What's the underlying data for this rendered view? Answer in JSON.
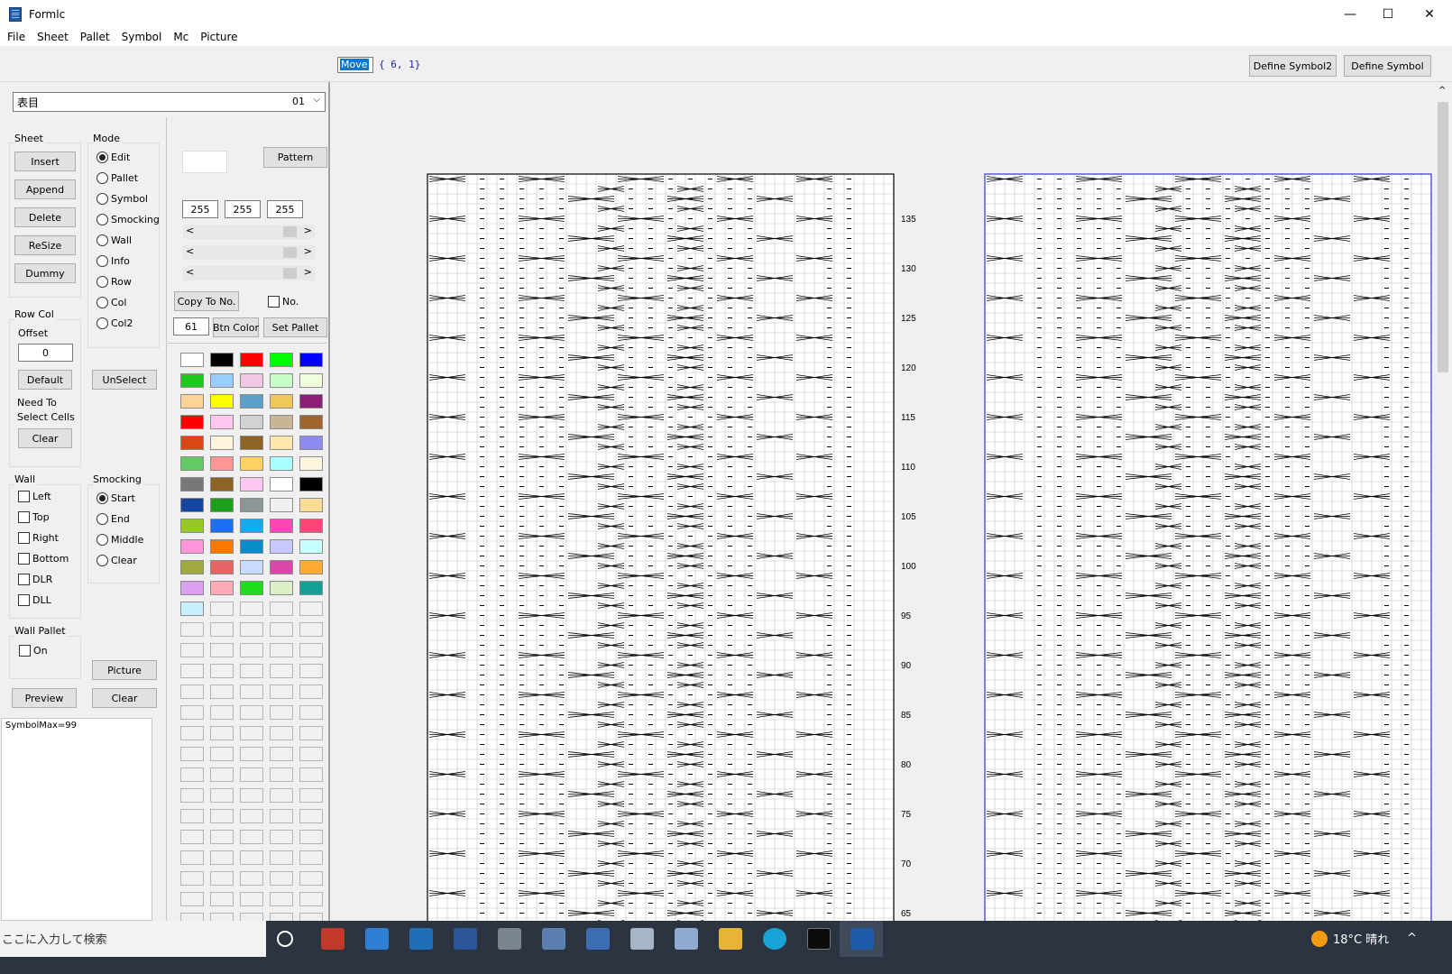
{
  "window": {
    "title": "Formlc",
    "minimize_glyph": "—",
    "maximize_glyph": "☐",
    "close_glyph": "✕",
    "icon": "app-grid-icon"
  },
  "menu": [
    "File",
    "Sheet",
    "Pallet",
    "Symbol",
    "Mc",
    "Picture"
  ],
  "toolbar": {
    "mode_value": "Move",
    "coords": "{ 6, 1}",
    "define_symbol2": "Define Symbol2",
    "define_symbol": "Define Symbol"
  },
  "sheet_select": {
    "value": "表目",
    "number": "01",
    "chevron": "⌵"
  },
  "sheet_group": {
    "label": "Sheet",
    "buttons": [
      "Insert",
      "Append",
      "Delete",
      "ReSize",
      "Dummy"
    ]
  },
  "mode_group": {
    "label": "Mode",
    "options": [
      "Edit",
      "Pallet",
      "Symbol",
      "Smocking",
      "Wall",
      "Info",
      "Row",
      "Col",
      "Col2"
    ],
    "selected": "Edit"
  },
  "rowcol_group": {
    "label": "Row Col",
    "offset_label": "Offset",
    "offset_value": "0",
    "default_label": "Default",
    "need_line1": "Need To",
    "need_line2": "Select Cells",
    "clear_label": "Clear"
  },
  "unselect_label": "UnSelect",
  "wall_group": {
    "label": "Wall",
    "options": [
      "Left",
      "Top",
      "Right",
      "Bottom",
      "DLR",
      "DLL"
    ]
  },
  "smocking_group": {
    "label": "Smocking",
    "options": [
      "Start",
      "End",
      "Middle",
      "Clear"
    ],
    "selected": "Start"
  },
  "wall_pallet_group": {
    "label": "Wall Pallet",
    "on_label": "On"
  },
  "picture_label": "Picture",
  "preview_label": "Preview",
  "clear2_label": "Clear",
  "info_text": "SymbolMax=99",
  "color": {
    "pattern_label": "Pattern",
    "r": "255",
    "g": "255",
    "b": "255",
    "copy_label": "Copy To No.",
    "no_label": "No.",
    "index": "61",
    "btn_color_label": "Btn Color",
    "set_pallet_label": "Set Pallet",
    "scroll_left": "<",
    "scroll_right": ">"
  },
  "palette": [
    "#ffffff",
    "#000000",
    "#ff0000",
    "#00ff00",
    "#0000ff",
    "#1ec81e",
    "#99ccff",
    "#f0c8e6",
    "#c8ffc8",
    "#f0ffdc",
    "#ffd296",
    "#ffff00",
    "#5aa0c8",
    "#f0c85a",
    "#8c1e78",
    "#ff0000",
    "#ffc8f0",
    "#d2d2d2",
    "#c8b496",
    "#a0642d",
    "#dc4614",
    "#fff5dc",
    "#8c6428",
    "#ffe6aa",
    "#8c8cf0",
    "#64c864",
    "#ff9696",
    "#ffd264",
    "#aaffff",
    "#fff5dc",
    "#787878",
    "#8c6428",
    "#ffc8f0",
    "#ffffff",
    "#000000",
    "#1446a0",
    "#1ea01e",
    "#8c9696",
    "#f0f0f0",
    "#ffdc96",
    "#96c828",
    "#1e6ef0",
    "#14aaf0",
    "#ff46b4",
    "#ff4678",
    "#ff96dc",
    "#ff7800",
    "#0a8cc8",
    "#c8c8ff",
    "#c8ffff",
    "#a0aa3c",
    "#e66464",
    "#c8dcff",
    "#dc46aa",
    "#ffaa32",
    "#dca0f0",
    "#ffaab4",
    "#1edc1e",
    "#dcf0c8",
    "#14a096",
    "#c8f0ff"
  ],
  "chart_rows": [
    "135",
    "130",
    "125",
    "120",
    "115",
    "110",
    "105",
    "100",
    "95",
    "90",
    "85",
    "80",
    "75",
    "70",
    "65"
  ],
  "taskbar": {
    "search": "ここに入力して検索",
    "weather": "18°C 晴れ",
    "tray": "^"
  }
}
